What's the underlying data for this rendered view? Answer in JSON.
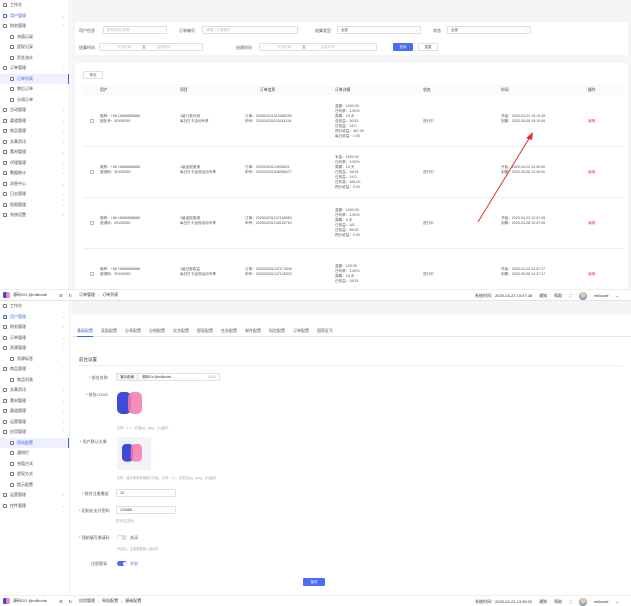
{
  "colors": {
    "accent": "#4a6cf7",
    "danger": "#e84b4b",
    "annotation_red": "#e0302a",
    "logo_blue": "#3d4bd6",
    "logo_pink": "#f37ab0"
  },
  "panel1": {
    "sidebar": [
      {
        "label": "工作台",
        "icon": "home-icon",
        "chev": ""
      },
      {
        "label": "用户管理",
        "icon": "user-icon",
        "chev": "⌄",
        "hl": true
      },
      {
        "label": "财务管理",
        "icon": "wallet-icon",
        "chev": "⌃"
      },
      {
        "label": "充值记录",
        "icon": "list-icon",
        "chev": "",
        "sub": true
      },
      {
        "label": "提现记录",
        "icon": "list-icon",
        "chev": "",
        "sub": true
      },
      {
        "label": "资金流水",
        "icon": "list-icon",
        "chev": "",
        "sub": true
      },
      {
        "label": "订单管理",
        "icon": "order-icon",
        "chev": "⌃"
      },
      {
        "label": "订单列表",
        "icon": "list-icon",
        "chev": "",
        "sub": true,
        "active": true
      },
      {
        "label": "售后订单",
        "icon": "list-icon",
        "chev": "",
        "sub": true
      },
      {
        "label": "分润订单",
        "icon": "list-icon",
        "chev": "",
        "sub": true
      },
      {
        "label": "活动管理",
        "icon": "gift-icon",
        "chev": "⌄"
      },
      {
        "label": "渠道管理",
        "icon": "channel-icon",
        "chev": "⌄"
      },
      {
        "label": "商品管理",
        "icon": "goods-icon",
        "chev": "⌄"
      },
      {
        "label": "文章资讯",
        "icon": "doc-icon",
        "chev": "⌄"
      },
      {
        "label": "素材管理",
        "icon": "image-icon",
        "chev": "⌄"
      },
      {
        "label": "代理管理",
        "icon": "agent-icon",
        "chev": "⌄"
      },
      {
        "label": "数据统计",
        "icon": "chart-icon",
        "chev": "⌄"
      },
      {
        "label": "消息中心",
        "icon": "bell-icon",
        "chev": "⌄"
      },
      {
        "label": "日志管理",
        "icon": "log-icon",
        "chev": "⌄"
      },
      {
        "label": "权限管理",
        "icon": "lock-icon",
        "chev": "⌄"
      },
      {
        "label": "系统设置",
        "icon": "gear-icon",
        "chev": "⌄"
      }
    ],
    "filters": {
      "user_info_label": "用户信息",
      "user_info_ph": "账号/姓名/昵称",
      "order_no_label": "订单编号",
      "order_no_ph": "请输入订单编号",
      "settle_type_label": "结算类型",
      "settle_type_val": "全部",
      "status_label": "状态",
      "status_val": "全部",
      "settle_time_label": "结算时间",
      "start_ph": "开始时间",
      "sep": "至",
      "end_ph": "结束时间",
      "create_time_label": "创建时间",
      "search_btn": "查询",
      "reset_btn": "重置"
    },
    "export_btn": "导出",
    "columns": [
      "用户",
      "项目",
      "订单信息",
      "订单详情",
      "状态",
      "时间",
      "操作"
    ],
    "rows": [
      {
        "user": [
          "昵称：+86 18888888888",
          "团队号：50150050"
        ],
        "project": [
          "1级订单分润",
          "每日打卡活动专享"
        ],
        "order": [
          "订单：202504231515485295",
          "申号：202504230215161154"
        ],
        "detail": [
          "金额：1000.00",
          "日利率：3.50%",
          "周期：15 天",
          "总收益：30/15",
          "日收益：14.0",
          "预计收益：467.00",
          "每日收益：1.00"
        ],
        "status": "进行中",
        "time": [
          "开始：2025-04-23 15:15:45",
          "到期：2025-05-08 15:15:45"
        ],
        "op": "编辑"
      },
      {
        "user": [
          "昵称：+86 18888888888",
          "邀请码：50150050"
        ],
        "project": [
          "1级返现邀请",
          "每日打卡返现活动专享"
        ],
        "order": [
          "订单：20250423124908521",
          "申号：202504231548958477"
        ],
        "detail": [
          "本金：1000.00",
          "日利率：3.50%",
          "周期：15 天",
          "已收益：15/15",
          "日收益：14.0",
          "日利息：465.00",
          "预计收益：3.00"
        ],
        "status": "进行中",
        "time": [
          "开始：2025-04-23 12:49:50",
          "到期：2025-05-08 12:49:50"
        ],
        "op": "编辑"
      },
      {
        "user": [
          "昵称：+86 18888888888",
          "邀请码：50150050"
        ],
        "project": [
          "1级返现邀请",
          "每日打卡返现活动专享"
        ],
        "order": [
          "订单：202504231247185983",
          "申号：202504231248152763"
        ],
        "detail": [
          "金额：1000.00",
          "日利率：3.50%",
          "周期：5 天",
          "已收益：3/5",
          "日收益：58.00",
          "预计收益：0.00"
        ],
        "status": "进行中",
        "time": [
          "开始：2025-04-23 12:47:45",
          "到期：2025-04-28 12:47:45"
        ],
        "op": "编辑"
      },
      {
        "user": [
          "昵称：+86 18888888888",
          "邀请码：50150050"
        ],
        "project": [
          "1级日报收益",
          "每日打卡返现活动专享"
        ],
        "order": [
          "订单：202504231247174308",
          "申号：202504231247125023"
        ],
        "detail": [
          "金额：100.00",
          "日利率：3.00%",
          "周期：15 天",
          "已收益：15/15"
        ],
        "status": "进行中",
        "time": [
          "开始：2025-04-23 12:47:17",
          "到期：2025-05-08 12:47:17"
        ],
        "op": "编辑"
      }
    ],
    "statusbar": {
      "brand": "源码GO @milicode",
      "breadcrumb": [
        "订单管理",
        "订单列表"
      ],
      "sep": "/",
      "clock": "系统时间：2025-04-23 13:47:38",
      "links": [
        "通知",
        "帮助"
      ],
      "username": "milicode"
    }
  },
  "panel2": {
    "sidebar": [
      {
        "label": "工作台",
        "icon": "home-icon",
        "chev": ""
      },
      {
        "label": "用户管理",
        "icon": "user-icon",
        "chev": "⌄",
        "hl": true
      },
      {
        "label": "财务管理",
        "icon": "wallet-icon",
        "chev": "⌄"
      },
      {
        "label": "订单管理",
        "icon": "order-icon",
        "chev": "⌄"
      },
      {
        "label": "资源管理",
        "icon": "box-icon",
        "chev": "⌃"
      },
      {
        "label": "资源标签",
        "icon": "tag-icon",
        "chev": "",
        "sub": true
      },
      {
        "label": "商品管理",
        "icon": "goods-icon",
        "chev": "⌃"
      },
      {
        "label": "商品列表",
        "icon": "list-icon",
        "chev": "",
        "sub": true
      },
      {
        "label": "文章资讯",
        "icon": "doc-icon",
        "chev": "⌄"
      },
      {
        "label": "素材管理",
        "icon": "image-icon",
        "chev": "⌄"
      },
      {
        "label": "渠道管理",
        "icon": "channel-icon",
        "chev": "⌄"
      },
      {
        "label": "运营管理",
        "icon": "ops-icon",
        "chev": "⌄"
      },
      {
        "label": "应用管理",
        "icon": "app-icon",
        "chev": "⌃"
      },
      {
        "label": "网站配置",
        "icon": "gear-icon",
        "chev": "",
        "sub": true,
        "active": true
      },
      {
        "label": "通知栏",
        "icon": "bell-icon",
        "chev": "",
        "sub": true
      },
      {
        "label": "充值方式",
        "icon": "card-icon",
        "chev": "",
        "sub": true
      },
      {
        "label": "提现方式",
        "icon": "card-icon",
        "chev": "",
        "sub": true
      },
      {
        "label": "提示配置",
        "icon": "tip-icon",
        "chev": "",
        "sub": true
      },
      {
        "label": "运营管理",
        "icon": "ops-icon",
        "chev": "⌄"
      },
      {
        "label": "控件管理",
        "icon": "widget-icon",
        "chev": "⌄"
      }
    ],
    "tabs": [
      "基础配置",
      "奖励配置",
      "分享配置",
      "分销配置",
      "实名配置",
      "提现配置",
      "任务配置",
      "邮件配置",
      "短信配置",
      "订单配置",
      "国家区号"
    ],
    "section_title": "前台设置",
    "form": {
      "site_name_label": "* 前台名称",
      "site_name_prefix": "演示布局",
      "site_name_val": "源码Go @milicode",
      "site_name_count": "20/30",
      "logo_label": "* 前台LOGO",
      "logo_hint": "比例：1:1，可选jpg、jpeg、png图片",
      "avatar_label": "* 用户默认头像",
      "avatar_hint": "比例：建议使用规格图片头像，比例：1:1，仅支持jpg、jpeg、png图片",
      "kefu_label": "* 前台注册赠送",
      "kefu_val": "10",
      "pwd_label": "* 初始化支付密码",
      "pwd_val": "123456",
      "pwd_hint": "数字6位密码",
      "toggle1_label": "* 强制填写邀请码",
      "toggle1_state": "关闭",
      "toggle1_hint": "开启后，注册需要输入邀请码",
      "toggle2_label": "注册登录",
      "toggle2_state": "开启",
      "save_btn": "保存"
    },
    "statusbar": {
      "brand": "源码GO @milicode",
      "breadcrumb": [
        "应用管理",
        "网站配置",
        "基础配置"
      ],
      "sep": "/",
      "clock": "系统时间：2025-04-23 13:38:20",
      "links": [
        "通知",
        "帮助"
      ],
      "username": "milicode"
    }
  }
}
